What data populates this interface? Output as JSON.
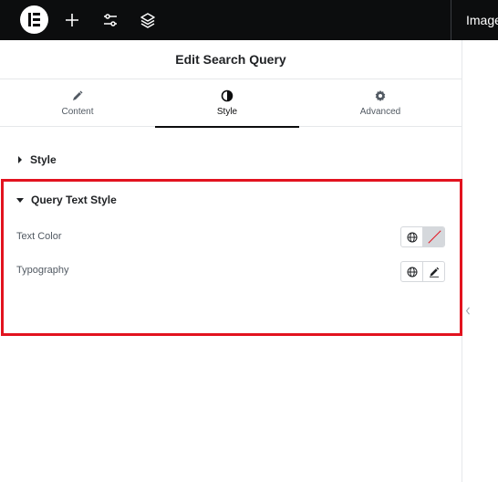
{
  "topbar": {
    "logo_icon": "elementor-logo-icon",
    "add_icon": "plus-icon",
    "settings_icon": "sliders-icon",
    "structure_icon": "layers-icon",
    "document_name": "Image"
  },
  "panel": {
    "title": "Edit Search Query",
    "tabs": [
      {
        "label": "Content",
        "icon": "pencil-icon"
      },
      {
        "label": "Style",
        "icon": "half-circle-icon",
        "active": true
      },
      {
        "label": "Advanced",
        "icon": "gear-icon"
      }
    ],
    "sections": [
      {
        "title": "Style",
        "expanded": false
      },
      {
        "title": "Query Text Style",
        "expanded": true
      }
    ],
    "controls": [
      {
        "label": "Text Color",
        "actions": [
          "globe-icon",
          "color-swatch-empty"
        ]
      },
      {
        "label": "Typography",
        "actions": [
          "globe-icon",
          "pencil-icon"
        ]
      }
    ]
  },
  "colors": {
    "highlight_border": "#e2131f",
    "topbar_bg": "#0c0d0e",
    "active_tab": "#0c0d0e"
  }
}
